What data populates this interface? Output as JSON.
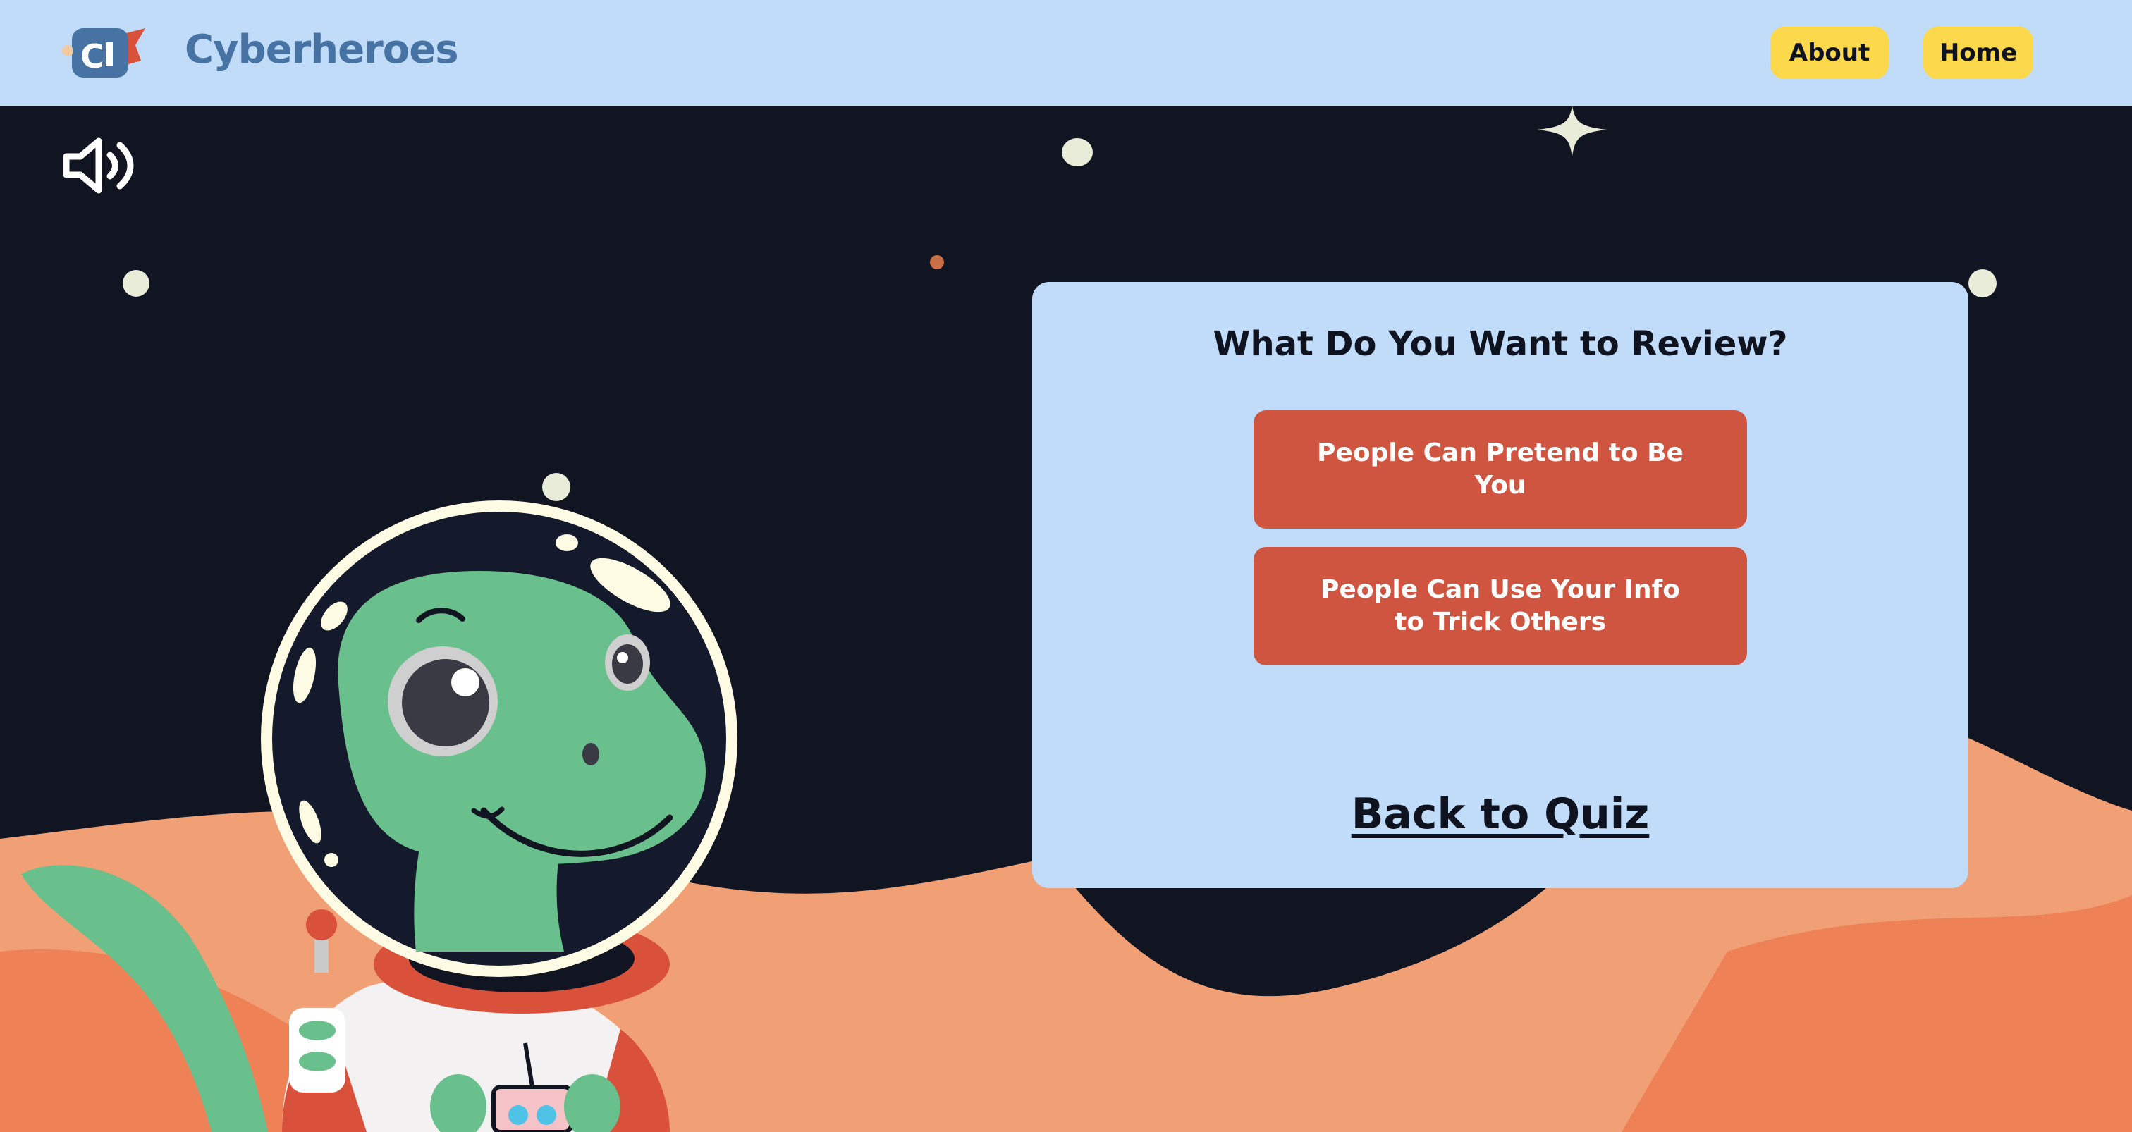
{
  "header": {
    "brand": "Cyberheroes",
    "logo_icon": "cyberheroes-logo-icon",
    "nav": {
      "about_label": "About",
      "home_label": "Home"
    }
  },
  "scene": {
    "sound_icon": "speaker-volume-icon"
  },
  "review_card": {
    "title": "What Do You Want to Review?",
    "options": [
      {
        "label": "People Can Pretend to Be You"
      },
      {
        "label": "People Can Use Your Info to Trick Others"
      }
    ],
    "back_label": "Back to Quiz"
  },
  "colors": {
    "header_bg": "#c0dcf9",
    "sky": "#111421",
    "nav_button": "#fcd94c",
    "option_button": "#cf5541",
    "brand_text": "#4773a4",
    "dune_light": "#f1a075",
    "dune_dark": "#ee8256",
    "dino_green": "#69c08d"
  }
}
